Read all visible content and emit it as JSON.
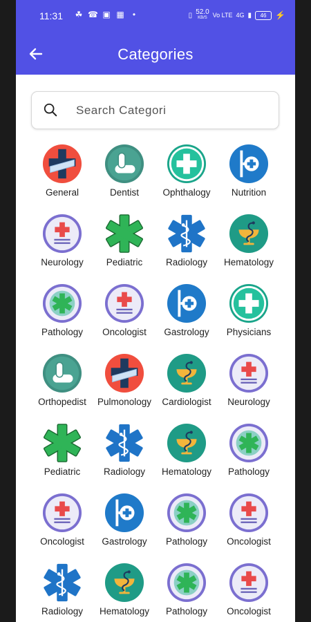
{
  "status_bar": {
    "time": "11:31",
    "speed_value": "52.0",
    "speed_unit": "KB/S",
    "volte": "Vo LTE",
    "network": "4G",
    "battery": "46"
  },
  "header": {
    "title": "Categories",
    "accent_color": "#5151e5"
  },
  "search": {
    "placeholder": "Search Categori"
  },
  "categories": [
    {
      "label": "General",
      "icon": "cross-bandage-icon"
    },
    {
      "label": "Dentist",
      "icon": "pill-capsule-icon"
    },
    {
      "label": "Ophthalogy",
      "icon": "plus-teal-icon"
    },
    {
      "label": "Nutrition",
      "icon": "hospital-sign-icon"
    },
    {
      "label": "Neurology",
      "icon": "cross-lines-icon"
    },
    {
      "label": "Pediatric",
      "icon": "star-of-life-green-icon"
    },
    {
      "label": "Radiology",
      "icon": "star-of-life-caduceus-icon"
    },
    {
      "label": "Hematology",
      "icon": "bowl-of-hygieia-icon"
    },
    {
      "label": "Pathology",
      "icon": "asterisk-purple-icon"
    },
    {
      "label": "Oncologist",
      "icon": "cross-lines-icon"
    },
    {
      "label": "Gastrology",
      "icon": "hospital-sign-icon"
    },
    {
      "label": "Physicians",
      "icon": "plus-teal-icon"
    },
    {
      "label": "Orthopedist",
      "icon": "pill-capsule-icon"
    },
    {
      "label": "Pulmonology",
      "icon": "cross-bandage-icon"
    },
    {
      "label": "Cardiologist",
      "icon": "bowl-of-hygieia-icon"
    },
    {
      "label": "Neurology",
      "icon": "cross-lines-icon"
    },
    {
      "label": "Pediatric",
      "icon": "star-of-life-green-icon"
    },
    {
      "label": "Radiology",
      "icon": "star-of-life-caduceus-icon"
    },
    {
      "label": "Hematology",
      "icon": "bowl-of-hygieia-icon"
    },
    {
      "label": "Pathology",
      "icon": "asterisk-purple-icon"
    },
    {
      "label": "Oncologist",
      "icon": "cross-lines-icon"
    },
    {
      "label": "Gastrology",
      "icon": "hospital-sign-icon"
    },
    {
      "label": "Pathology",
      "icon": "asterisk-purple-icon"
    },
    {
      "label": "Oncologist",
      "icon": "cross-lines-icon"
    },
    {
      "label": "Radiology",
      "icon": "star-of-life-caduceus-icon"
    },
    {
      "label": "Hematology",
      "icon": "bowl-of-hygieia-icon"
    },
    {
      "label": "Pathology",
      "icon": "asterisk-purple-icon"
    },
    {
      "label": "Oncologist",
      "icon": "cross-lines-icon"
    }
  ]
}
